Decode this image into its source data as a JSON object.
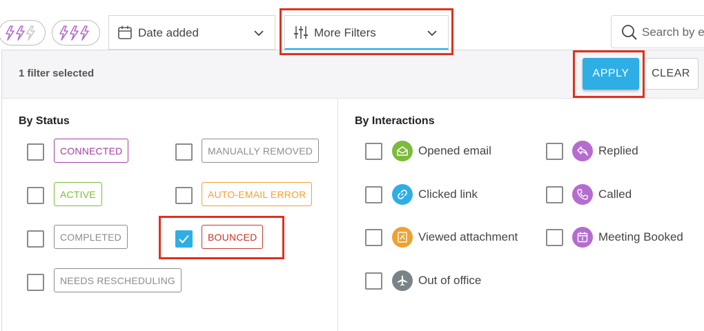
{
  "toolbar": {
    "date_dropdown_label": "Date added",
    "more_filters_label": "More Filters",
    "search_placeholder": "Search by e"
  },
  "filter_panel": {
    "selected_count_text": "1 filter selected",
    "apply_label": "APPLY",
    "clear_label": "CLEAR"
  },
  "by_status": {
    "title": "By Status",
    "items": [
      {
        "label": "CONNECTED",
        "checked": false,
        "color": "#a33ca8"
      },
      {
        "label": "MANUALLY REMOVED",
        "checked": false,
        "color": "#8c8c8c"
      },
      {
        "label": "ACTIVE",
        "checked": false,
        "color": "#7cbb3a"
      },
      {
        "label": "AUTO-EMAIL ERROR",
        "checked": false,
        "color": "#f0a030"
      },
      {
        "label": "COMPLETED",
        "checked": false,
        "color": "#8c8c8c"
      },
      {
        "label": "BOUNCED",
        "checked": true,
        "color": "#c8342c"
      },
      {
        "label": "NEEDS RESCHEDULING",
        "checked": false,
        "color": "#8c8c8c"
      }
    ]
  },
  "by_interactions": {
    "title": "By Interactions",
    "items": [
      {
        "label": "Opened email",
        "checked": false,
        "icon": "envelope-open-icon",
        "color": "#7cbb3a"
      },
      {
        "label": "Replied",
        "checked": false,
        "icon": "reply-icon",
        "color": "#b56ccf"
      },
      {
        "label": "Clicked link",
        "checked": false,
        "icon": "link-icon",
        "color": "#2eaee5"
      },
      {
        "label": "Called",
        "checked": false,
        "icon": "phone-icon",
        "color": "#b56ccf"
      },
      {
        "label": "Viewed attachment",
        "checked": false,
        "icon": "attachment-icon",
        "color": "#f0a030"
      },
      {
        "label": "Meeting Booked",
        "checked": false,
        "icon": "calendar-icon",
        "color": "#b56ccf"
      },
      {
        "label": "Out of office",
        "checked": false,
        "icon": "airplane-icon",
        "color": "#7a8488"
      }
    ]
  },
  "colors": {
    "accent": "#2eaee5",
    "highlight": "#e0301e",
    "bolt": "#b56ccf"
  }
}
